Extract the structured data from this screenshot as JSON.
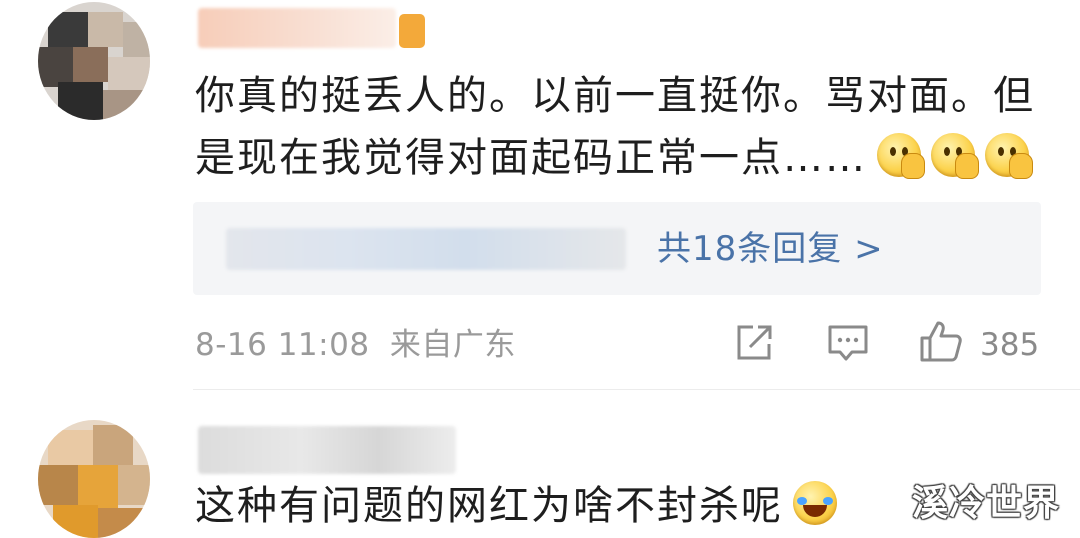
{
  "comments": [
    {
      "text_line1": "你真的挺丢人的。以前一直挺你。骂对面。但",
      "text_line2": "是现在我觉得对面起码正常一点……",
      "emojis": [
        "thinking-face",
        "thinking-face",
        "thinking-face"
      ],
      "replies_link": "共18条回复 >",
      "timestamp": "8-16 11:08",
      "location": "来自广东",
      "like_count": "385"
    },
    {
      "text": "这种有问题的网红为啥不封杀呢",
      "emoji": "laughing-crying-face"
    }
  ],
  "watermark": "溪冷世界",
  "colors": {
    "link": "#4a73a8",
    "meta": "#9a9a9a",
    "reply_bg": "#f4f5f7"
  }
}
